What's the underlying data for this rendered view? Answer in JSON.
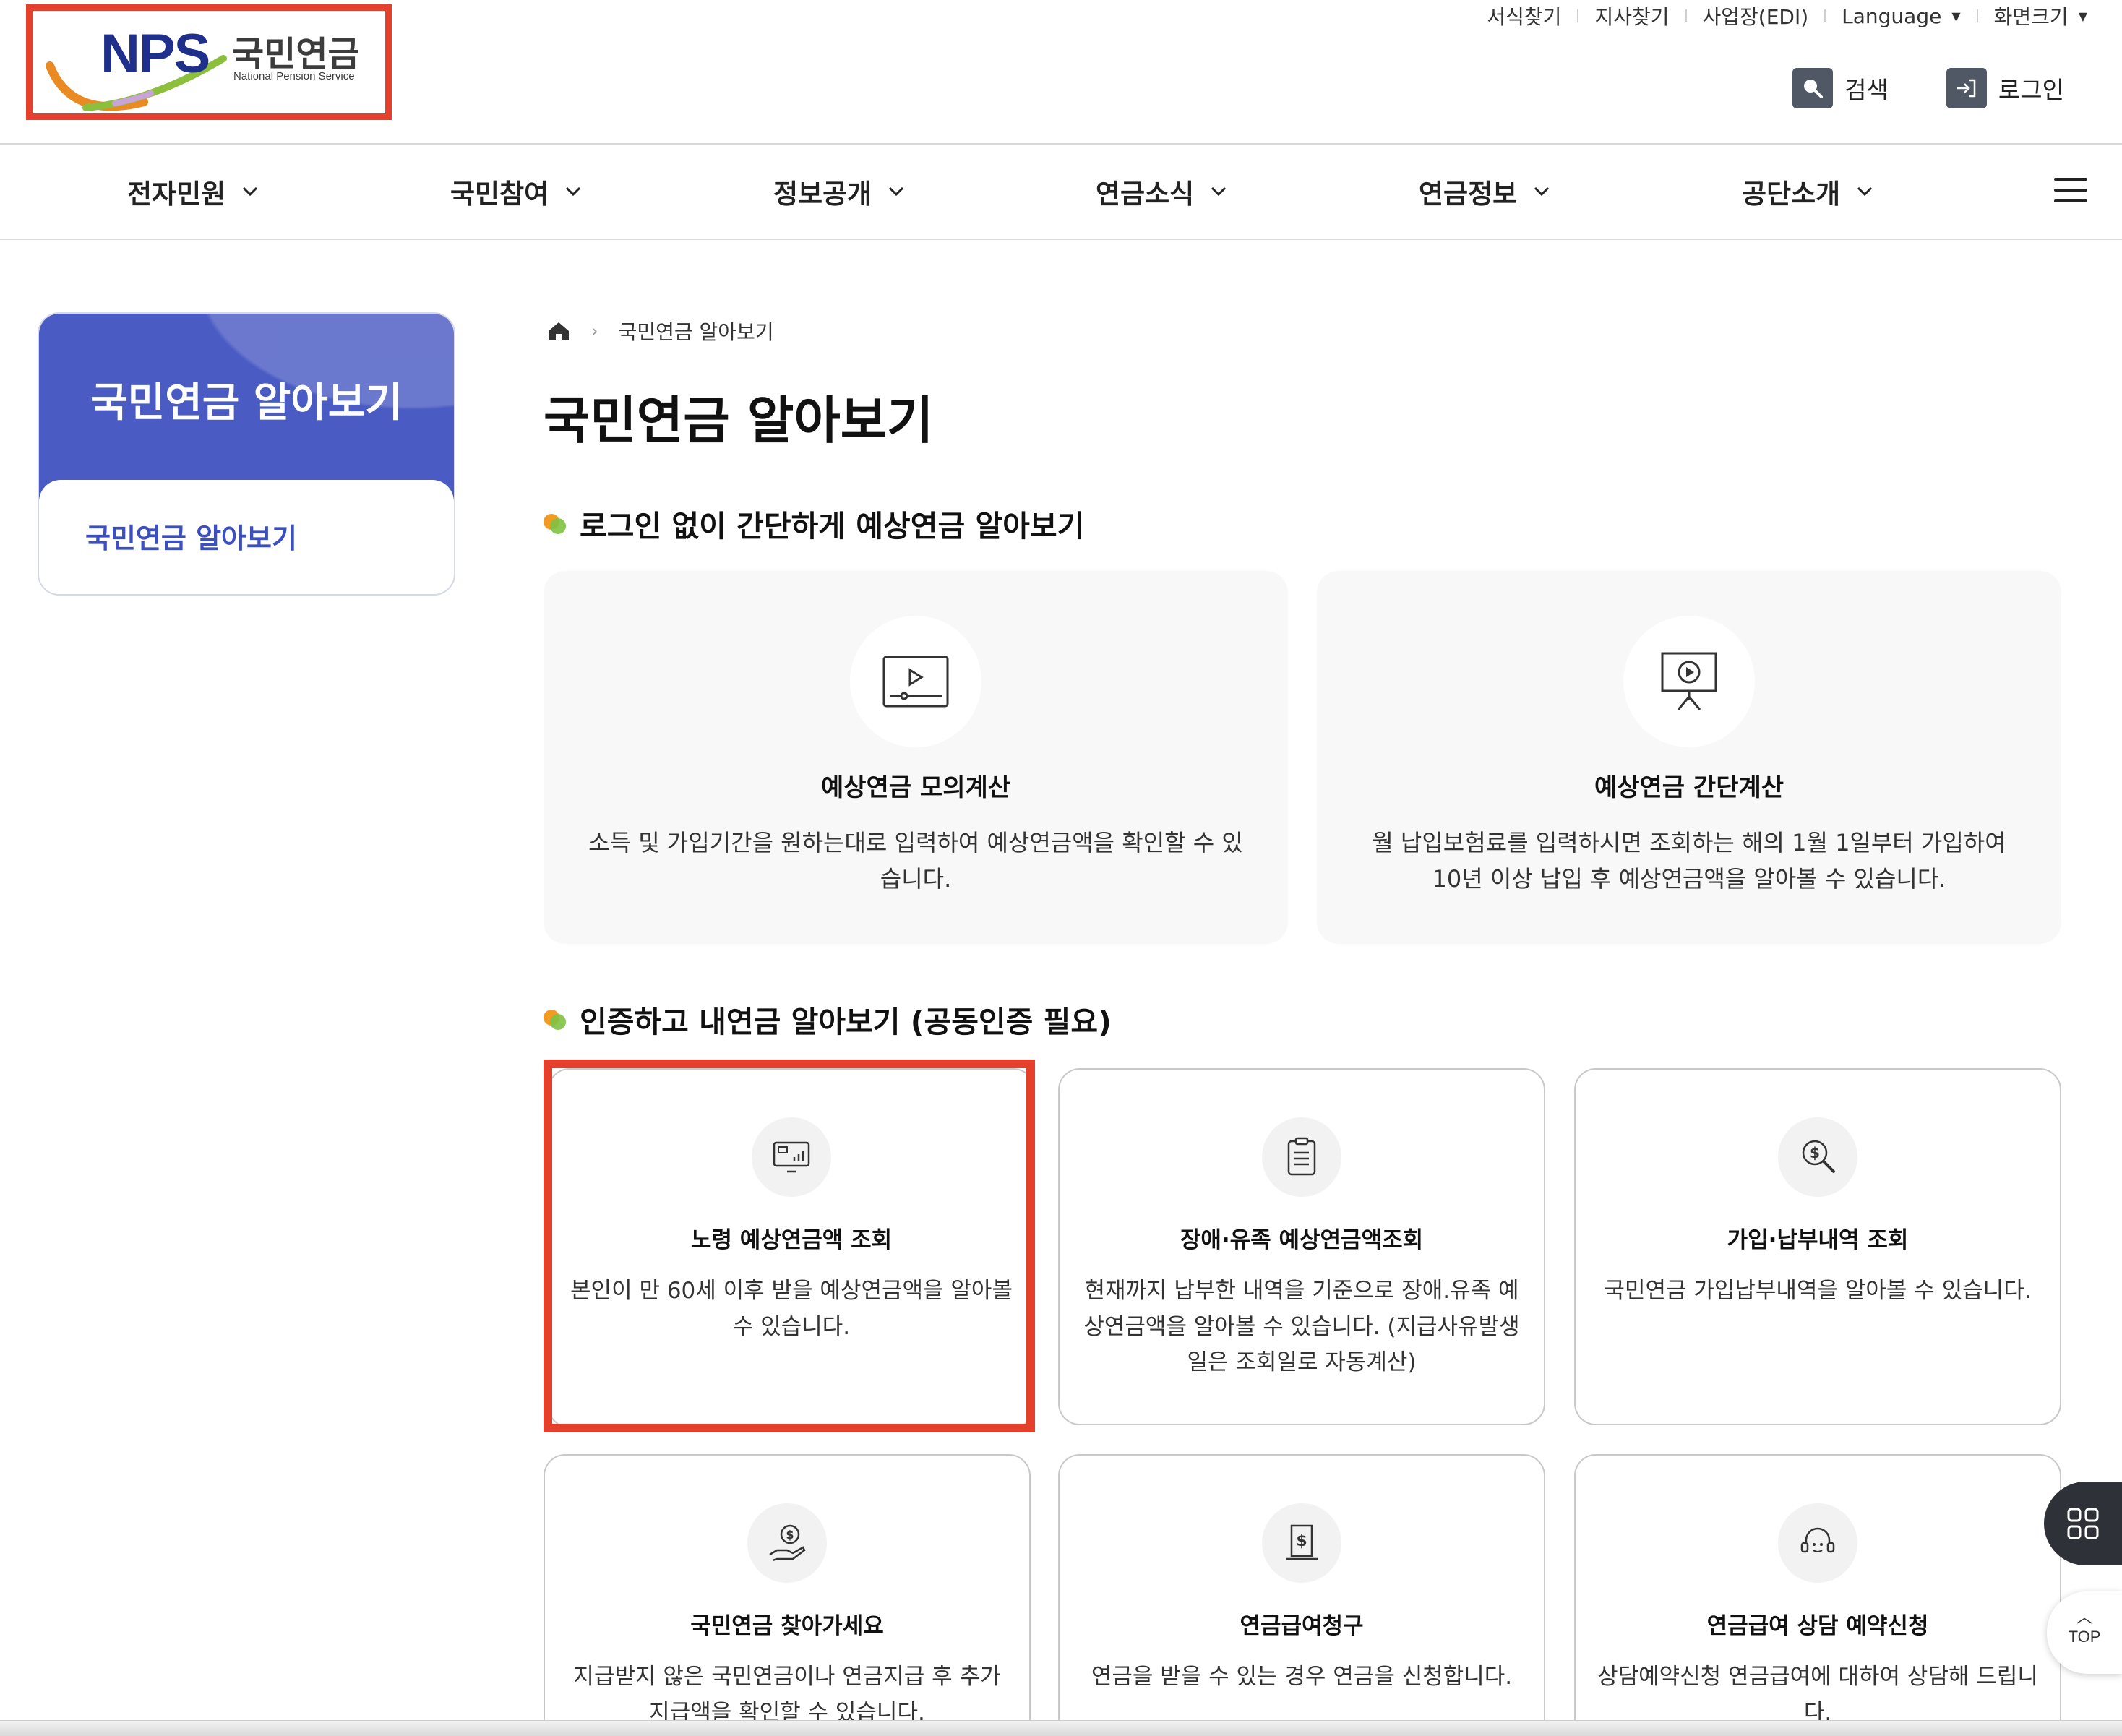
{
  "header": {
    "logo": {
      "mark": "NPS",
      "name_kr": "국민연금",
      "name_en": "National Pension Service"
    },
    "util_links": [
      {
        "label": "서식찾기"
      },
      {
        "label": "지사찾기"
      },
      {
        "label": "사업장(EDI)"
      },
      {
        "label": "Language",
        "dropdown": true
      },
      {
        "label": "화면크기",
        "dropdown": true
      }
    ],
    "search_label": "검색",
    "login_label": "로그인"
  },
  "nav": {
    "items": [
      "전자민원",
      "국민참여",
      "정보공개",
      "연금소식",
      "연금정보",
      "공단소개"
    ]
  },
  "sidebar": {
    "title": "국민연금 알아보기",
    "items": [
      "국민연금 알아보기"
    ]
  },
  "breadcrumb": {
    "current": "국민연금 알아보기"
  },
  "page_title": "국민연금 알아보기",
  "section1": {
    "title": "로그인 없이 간단하게 예상연금 알아보기",
    "cards": [
      {
        "icon": "video-play-icon",
        "title": "예상연금 모의계산",
        "desc": "소득 및 가입기간을 원하는대로 입력하여 예상연금액을 확인할 수 있습니다."
      },
      {
        "icon": "presentation-play-icon",
        "title": "예상연금 간단계산",
        "desc": "월 납입보험료를 입력하시면 조회하는 해의 1월 1일부터 가입하여 10년 이상 납입 후 예상연금액을 알아볼 수 있습니다."
      }
    ]
  },
  "section2": {
    "title": "인증하고 내연금 알아보기 (공동인증 필요)",
    "cards": [
      {
        "icon": "monitor-chart-icon",
        "title": "노령 예상연금액 조회",
        "desc": "본인이 만 60세 이후 받을 예상연금액을 알아볼 수 있습니다."
      },
      {
        "icon": "clipboard-list-icon",
        "title": "장애·유족 예상연금액조회",
        "desc": "현재까지 납부한 내역을 기준으로 장애.유족 예상연금액을 알아볼 수 있습니다. (지급사유발생일은 조회일로 자동계산)"
      },
      {
        "icon": "search-dollar-icon",
        "title": "가입·납부내역 조회",
        "desc": "국민연금 가입납부내역을 알아볼 수 있습니다."
      },
      {
        "icon": "hand-coin-icon",
        "title": "국민연금 찾아가세요",
        "desc": "지급받지 않은 국민연금이나 연금지급 후 추가 지급액을 확인할 수 있습니다."
      },
      {
        "icon": "document-dollar-icon",
        "title": "연금급여청구",
        "desc": "연금을 받을 수 있는 경우 연금을 신청합니다."
      },
      {
        "icon": "headset-icon",
        "title": "연금급여 상담 예약신청",
        "desc": "상담예약신청 연금급여에 대하여 상담해 드립니다."
      }
    ]
  },
  "floating": {
    "top_label": "TOP",
    "apps_icon": "grid-icon"
  },
  "colors": {
    "accent_red": "#e5402b",
    "sidebar_blue": "#4a5bc3",
    "link_blue": "#3c4fc0"
  }
}
